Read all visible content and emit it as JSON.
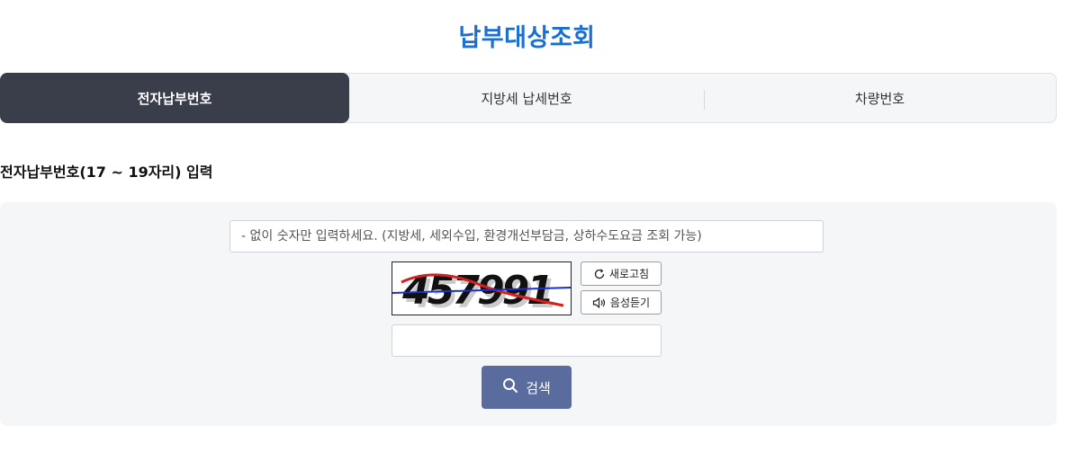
{
  "page": {
    "title": "납부대상조회"
  },
  "tabs": [
    {
      "label": "전자납부번호",
      "active": true
    },
    {
      "label": "지방세 납세번호",
      "active": false
    },
    {
      "label": "차량번호",
      "active": false
    }
  ],
  "section": {
    "title": "전자납부번호(17 ~ 19자리) 입력"
  },
  "form": {
    "number_placeholder": "- 없이 숫자만 입력하세요. (지방세, 세외수입, 환경개선부담금, 상하수도요금 조회 가능)",
    "captcha_text": "457991",
    "captcha_input_value": "",
    "refresh_label": "새로고침",
    "audio_label": "음성듣기",
    "search_label": "검색"
  },
  "colors": {
    "title": "#1a6fd0",
    "active_tab": "#3a3d4a",
    "search_button": "#5a6b9e",
    "panel_bg": "#f5f6f8"
  },
  "icons": {
    "refresh": "refresh-icon",
    "audio": "speaker-icon",
    "search": "search-icon"
  }
}
